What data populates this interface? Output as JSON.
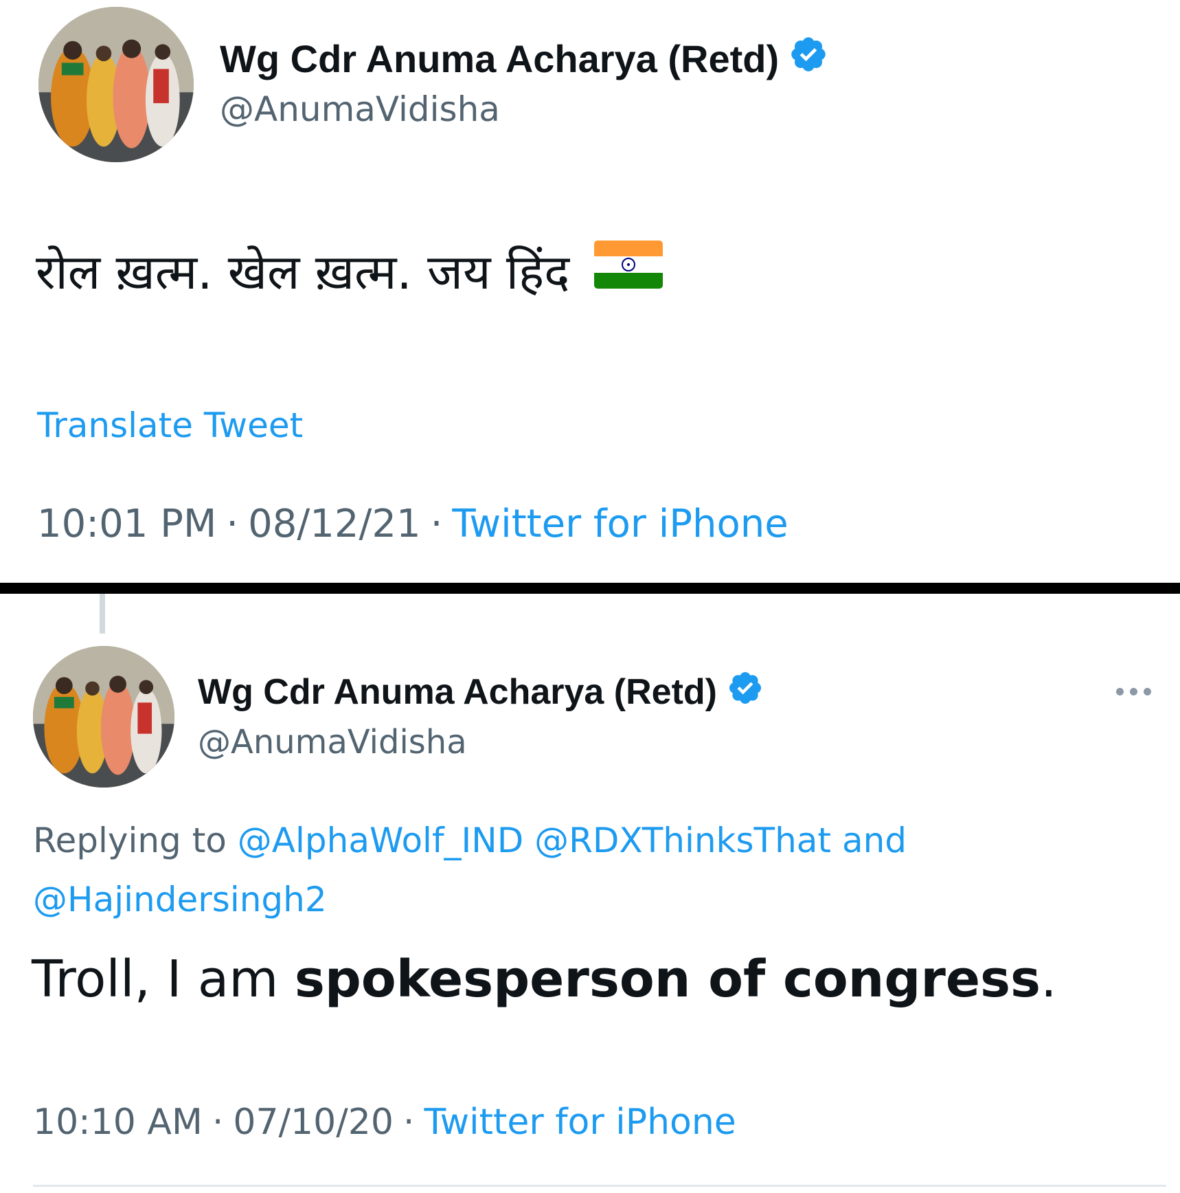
{
  "tweet1": {
    "display_name": "Wg Cdr Anuma Acharya (Retd)",
    "handle": "@AnumaVidisha",
    "text": "रोल ख़त्म. खेल ख़त्म. जय हिंद",
    "flag_emoji": "india-flag",
    "translate_label": "Translate Tweet",
    "time": "10:01 PM",
    "date": "08/12/21",
    "source": "Twitter for iPhone",
    "separator": "·"
  },
  "tweet2": {
    "display_name": "Wg Cdr Anuma Acharya (Retd)",
    "handle": "@AnumaVidisha",
    "replying_prefix": "Replying to",
    "reply_mention_1": "@AlphaWolf_IND",
    "reply_mention_2": "@RDXThinksThat",
    "reply_and": "and",
    "reply_mention_3": "@Hajindersingh2",
    "text_plain_1": "Troll, I am ",
    "text_bold": "spokesperson of congress",
    "text_plain_2": ".",
    "time": "10:10 AM",
    "date": "07/10/20",
    "source": "Twitter for iPhone",
    "separator": "·"
  },
  "colors": {
    "link": "#1d9bf0",
    "muted": "#536471",
    "text": "#0f1419",
    "verified": "#1d9bf0",
    "divider": "#000000"
  }
}
